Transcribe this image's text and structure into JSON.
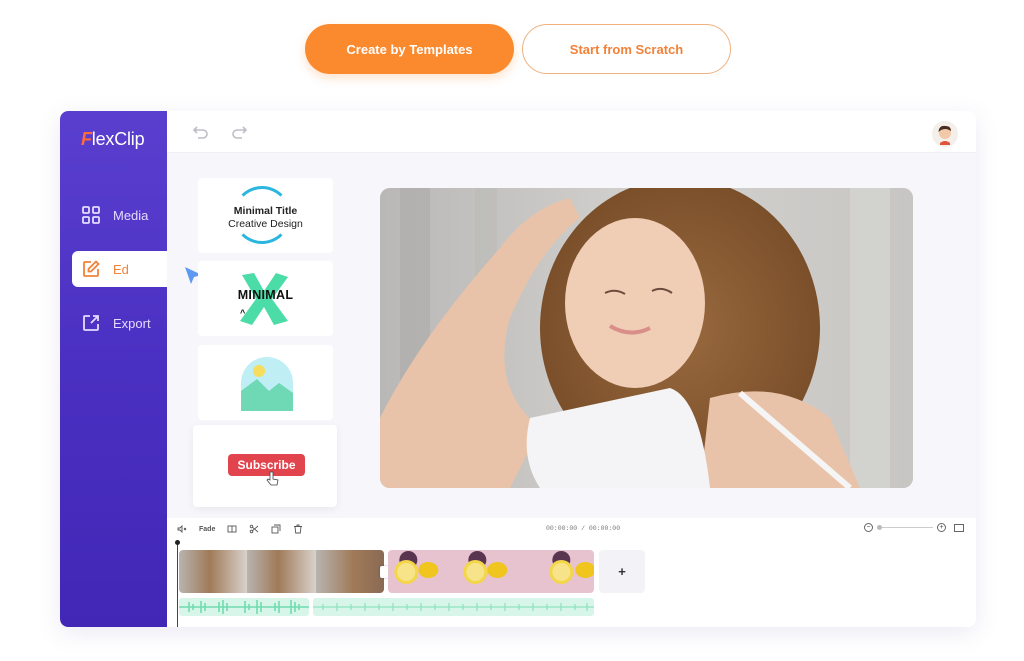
{
  "cta": {
    "primary_label": "Create by Templates",
    "secondary_label": "Start from Scratch",
    "primary_color": "#fb8a2e",
    "secondary_text_color": "#f2823a"
  },
  "app": {
    "logo_first": "F",
    "logo_rest": "lexClip",
    "sidebar": {
      "items": [
        {
          "label": "Media",
          "icon": "grid-icon",
          "active": false
        },
        {
          "label": "Ed",
          "icon": "edit-icon",
          "active": true
        },
        {
          "label": "Export",
          "icon": "export-icon",
          "active": false
        }
      ],
      "color": "#4a30c2"
    },
    "topbar": {
      "undo_icon": "undo-icon",
      "redo_icon": "redo-icon",
      "avatar": "user-avatar"
    },
    "templates": [
      {
        "type": "text",
        "line1": "Minimal Title",
        "line2": "Creative Design"
      },
      {
        "type": "text",
        "line1": "MINIMAL"
      },
      {
        "type": "image-placeholder"
      },
      {
        "type": "button",
        "label": "Subscribe"
      }
    ],
    "preview": {
      "description": "smiling woman with curly hair hugging a white pillow"
    },
    "timeline": {
      "tools": {
        "volume_icon": "volume-icon",
        "fade_label": "Fade",
        "split_icon": "split-icon",
        "cut_icon": "scissors-icon",
        "duplicate_icon": "duplicate-icon",
        "delete_icon": "trash-icon"
      },
      "time": "00:00:00 / 00:00:00",
      "zoom_level": 0,
      "clips": [
        {
          "name": "woman-clip",
          "frames": 3
        },
        {
          "name": "lemon-clip",
          "frames": 3
        }
      ],
      "add_label": "+"
    }
  }
}
